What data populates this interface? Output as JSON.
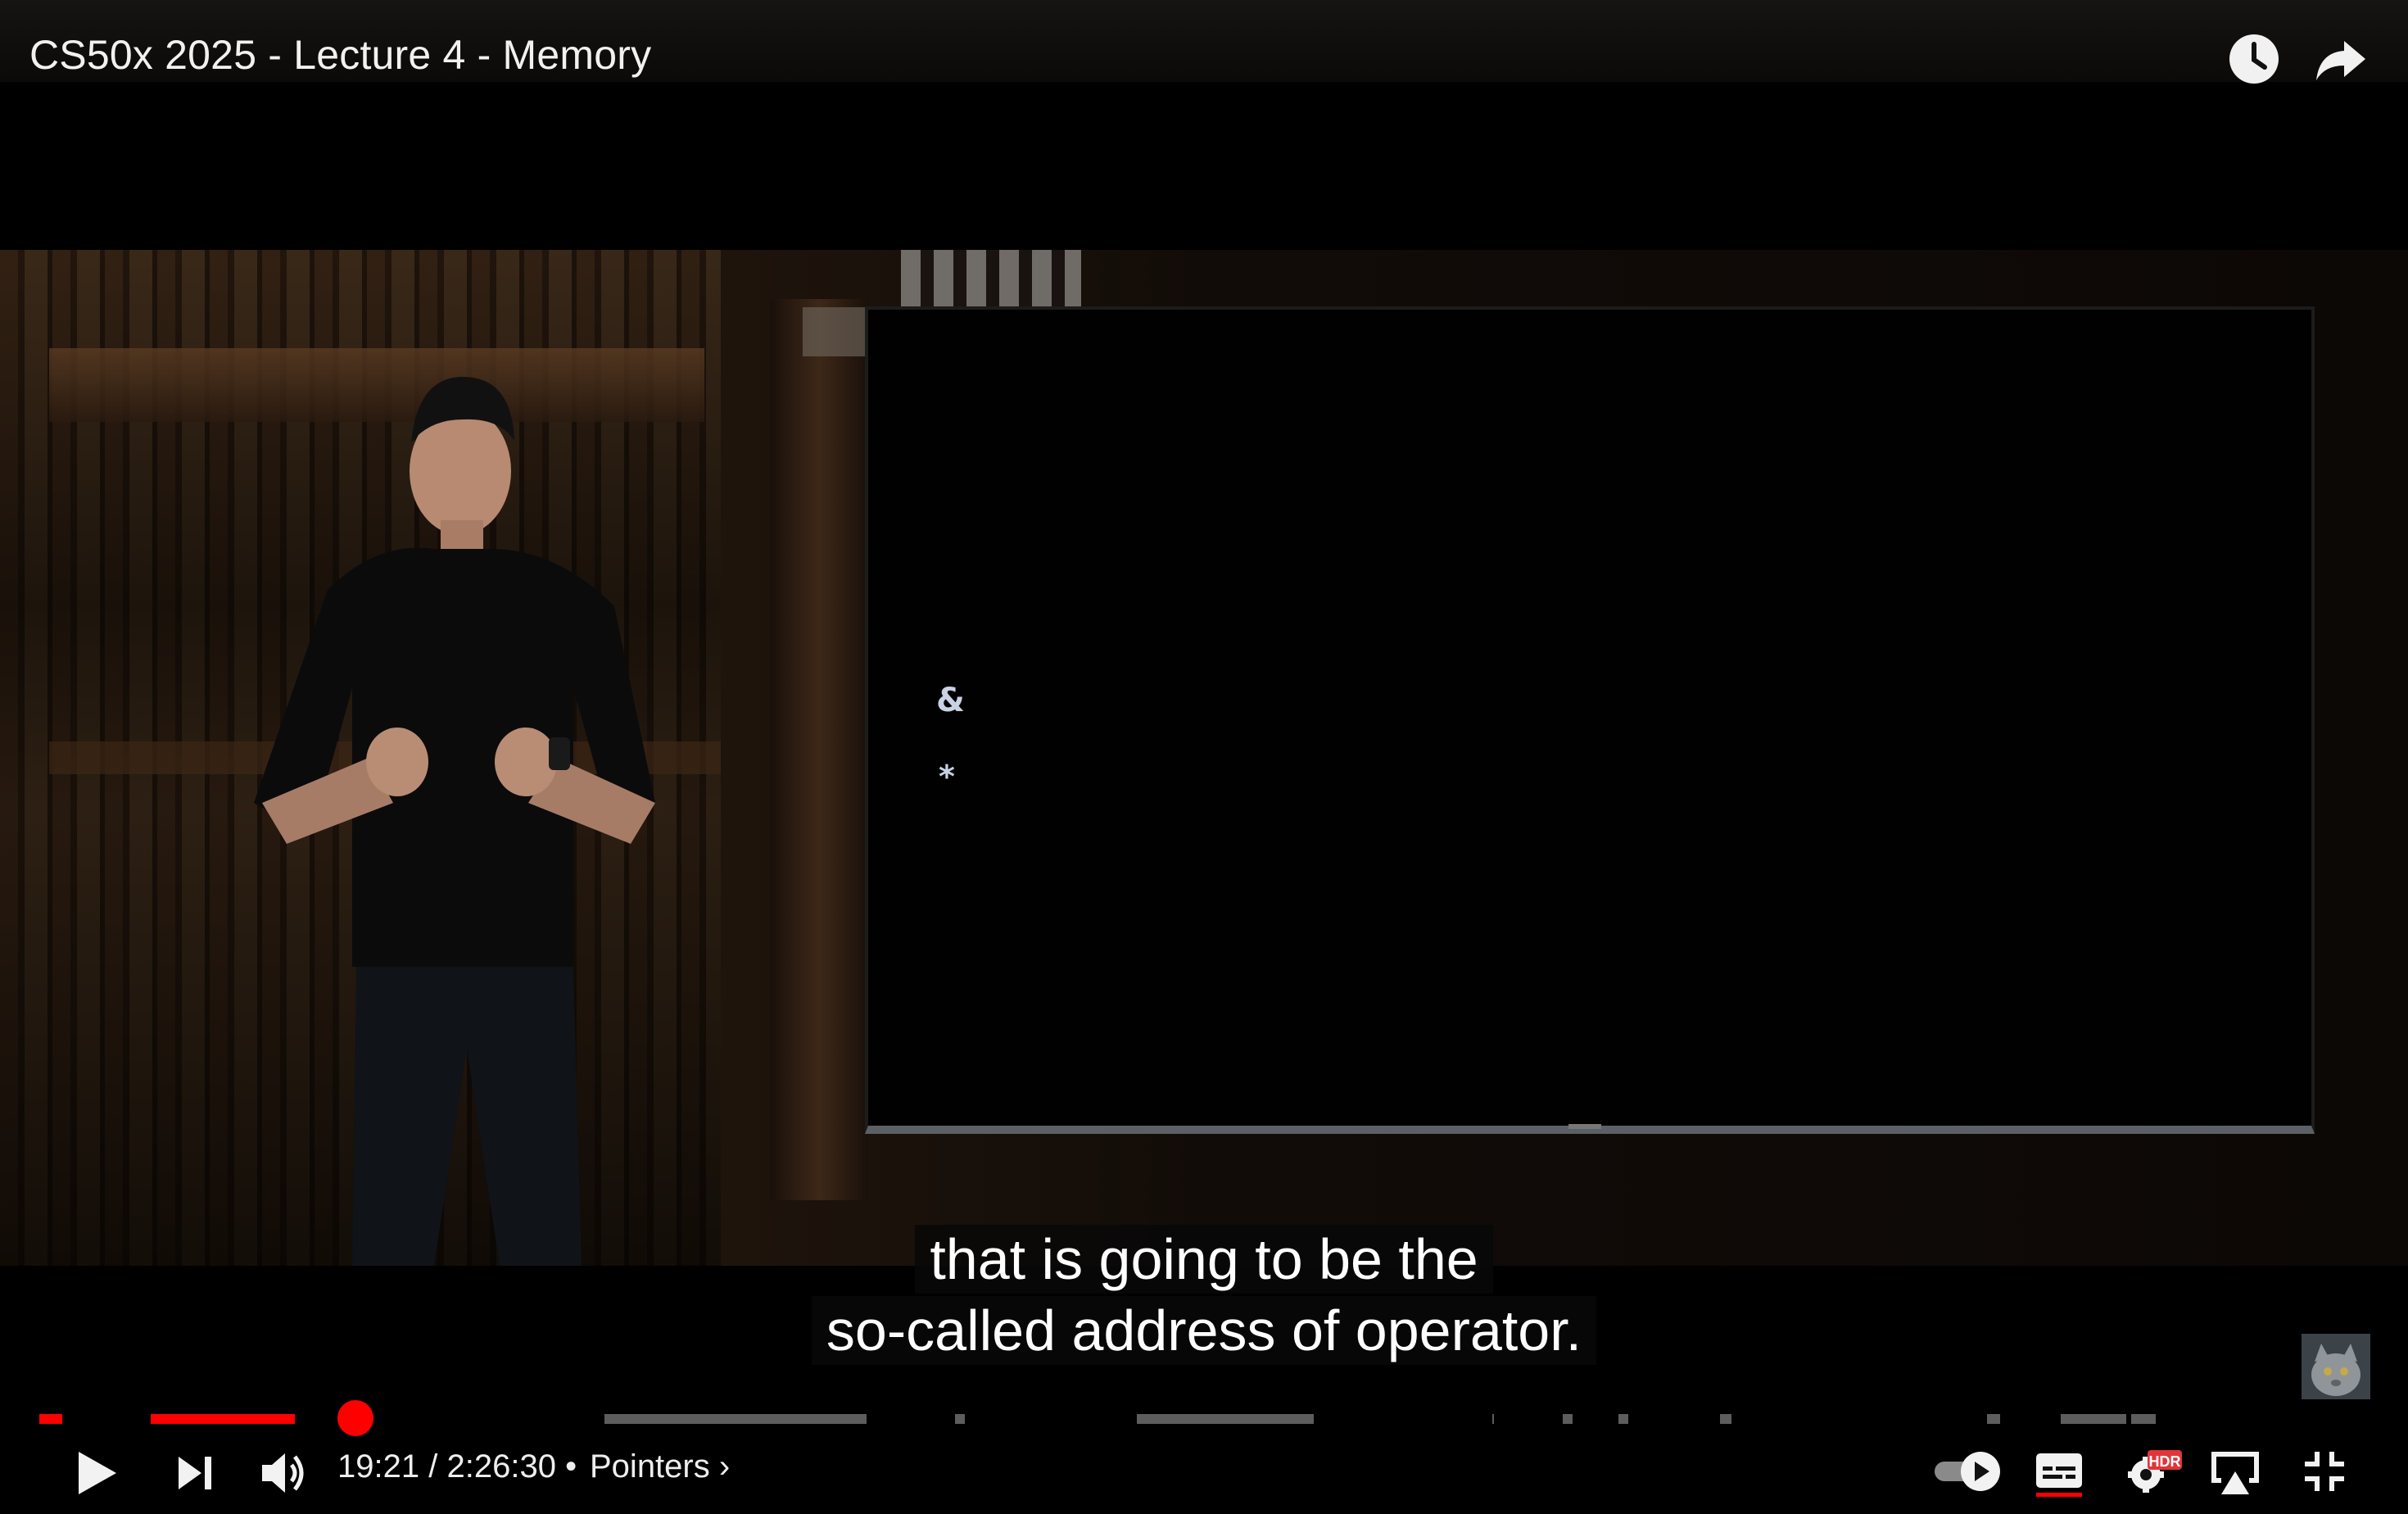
{
  "video": {
    "title": "CS50x 2025 - Lecture 4 - Memory"
  },
  "slide": {
    "symbols": [
      "&",
      "*"
    ]
  },
  "captions": {
    "line1": "that is going to be the",
    "line2": "so-called address of operator."
  },
  "playback": {
    "current_time": "19:21",
    "separator": "/",
    "duration": "2:26:30",
    "bullet": "•",
    "chapter": "Pointers",
    "chapter_chevron": "›",
    "played_fraction": 0.132
  },
  "controls": {
    "play_icon": "play-icon",
    "next_icon": "next-icon",
    "volume_icon": "volume-icon",
    "autoplay_icon": "autoplay-toggle-icon",
    "subtitles_icon": "subtitles-icon",
    "settings_badge": "HDR",
    "settings_icon": "gear-icon",
    "airplay_icon": "airplay-icon",
    "exit_fullscreen_icon": "exit-fullscreen-icon"
  },
  "colors": {
    "progress_played": "#ff0000",
    "progress_unplayed": "#5d5d5d",
    "hdr_badge": "#e0353a"
  }
}
